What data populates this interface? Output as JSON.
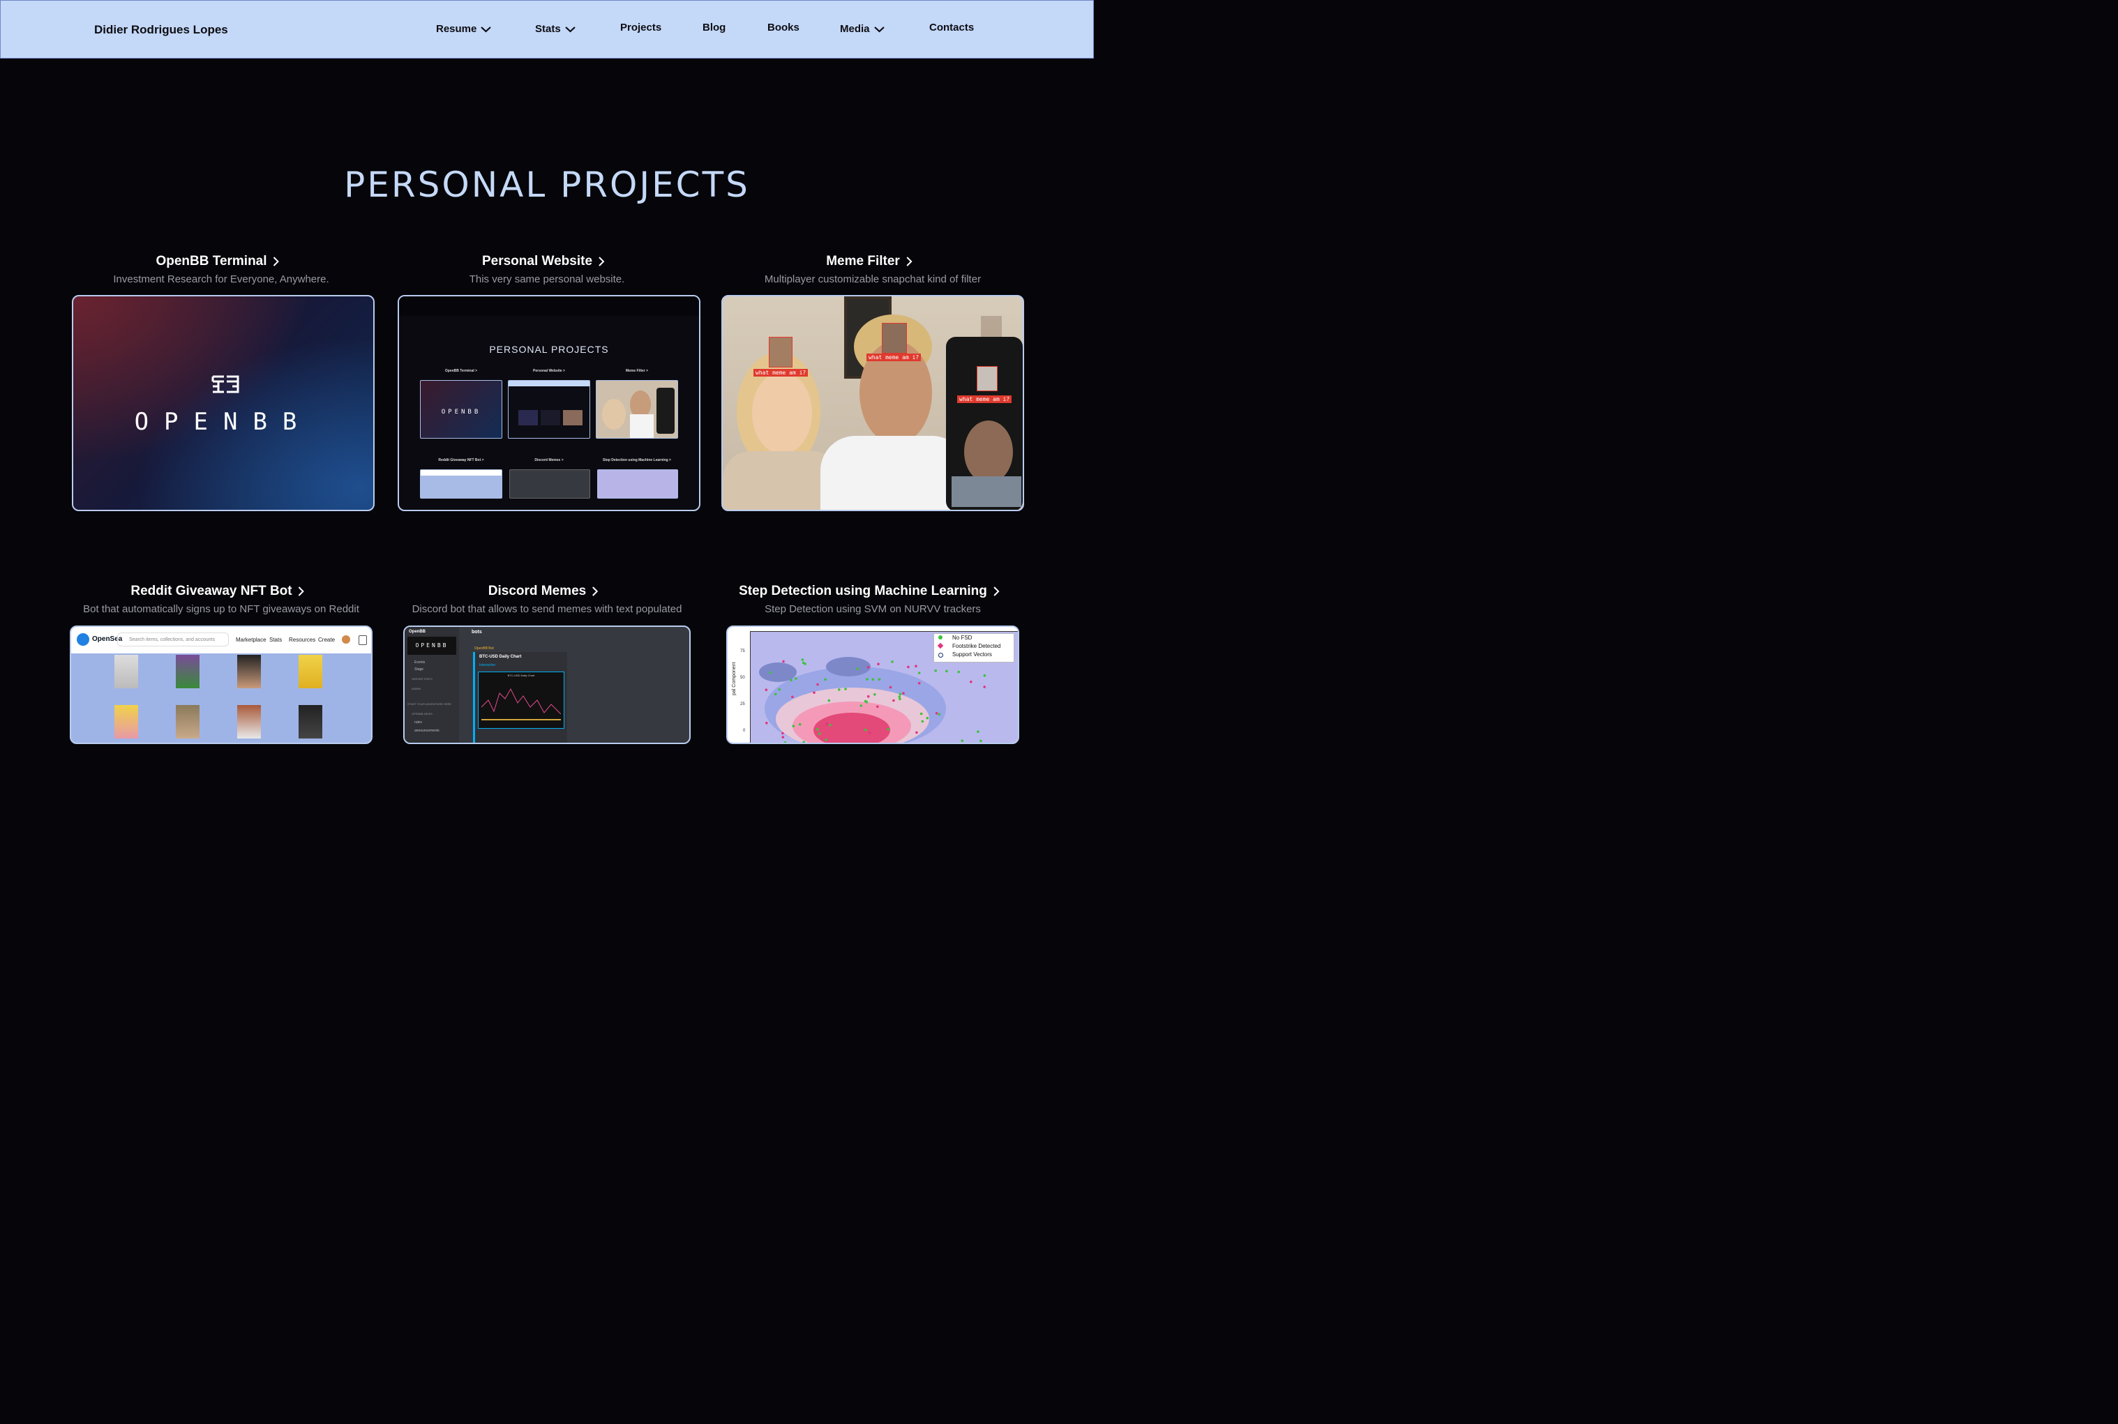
{
  "header": {
    "brand": "Didier Rodrigues Lopes",
    "nav": [
      {
        "label": "Resume",
        "has_dropdown": true
      },
      {
        "label": "Stats",
        "has_dropdown": true
      },
      {
        "label": "Projects",
        "has_dropdown": false
      },
      {
        "label": "Blog",
        "has_dropdown": false
      },
      {
        "label": "Books",
        "has_dropdown": false
      },
      {
        "label": "Media",
        "has_dropdown": true
      },
      {
        "label": "Contacts",
        "has_dropdown": false
      }
    ]
  },
  "main": {
    "title": "PERSONAL PROJECTS",
    "projects": [
      {
        "title": "OpenBB Terminal",
        "description": "Investment Research for Everyone, Anywhere."
      },
      {
        "title": "Personal Website",
        "description": "This very same personal website."
      },
      {
        "title": "Meme Filter",
        "description": "Multiplayer customizable snapchat kind of filter"
      },
      {
        "title": "Reddit Giveaway NFT Bot",
        "description": "Bot that automatically signs up to NFT giveaways on Reddit"
      },
      {
        "title": "Discord Memes",
        "description": "Discord bot that allows to send memes with text populated"
      },
      {
        "title": "Step Detection using Machine Learning",
        "description": "Step Detection using SVM on NURVV trackers"
      }
    ]
  },
  "thumbnails": {
    "openbb": {
      "wordmark": "OPENBB"
    },
    "website": {
      "title": "PERSONAL PROJECTS",
      "cards": [
        "OpenBB Terminal >",
        "Personal Website >",
        "Meme Filter >",
        "Reddit Giveaway NFT Bot >",
        "Discord Memes >",
        "Step Detection using Machine Learning >"
      ]
    },
    "meme": {
      "tag": "what meme am i?"
    },
    "opensea": {
      "brand": "OpenSea",
      "search_placeholder": "Search items, collections, and accounts",
      "nav": [
        "Marketplace",
        "Stats",
        "Resources",
        "Create"
      ]
    },
    "discord": {
      "server": "OpenBB",
      "channel": "bots",
      "bot_name": "OpenBB Bot",
      "embed_title": "BTC-USD Daily Chart",
      "embed_sub": "Interactive",
      "chart_title": "BTC-USD Daily Chart",
      "sidebar": [
        "Events",
        "Stage",
        "SERVER STATS",
        "ADMIN",
        "START YOUR ADVENTURE HERE",
        "OPENBB NEWS",
        "rules",
        "announcements"
      ]
    },
    "step": {
      "ylabel": "pal Component",
      "yticks": [
        "75",
        "50",
        "25",
        "0"
      ],
      "legend": [
        "No FSD",
        "Footstrike Detected",
        "Support Vectors"
      ],
      "colors": {
        "no_fsd": "#3cc23c",
        "fsd": "#e0367d",
        "sv": "#1a2a6c"
      }
    }
  }
}
